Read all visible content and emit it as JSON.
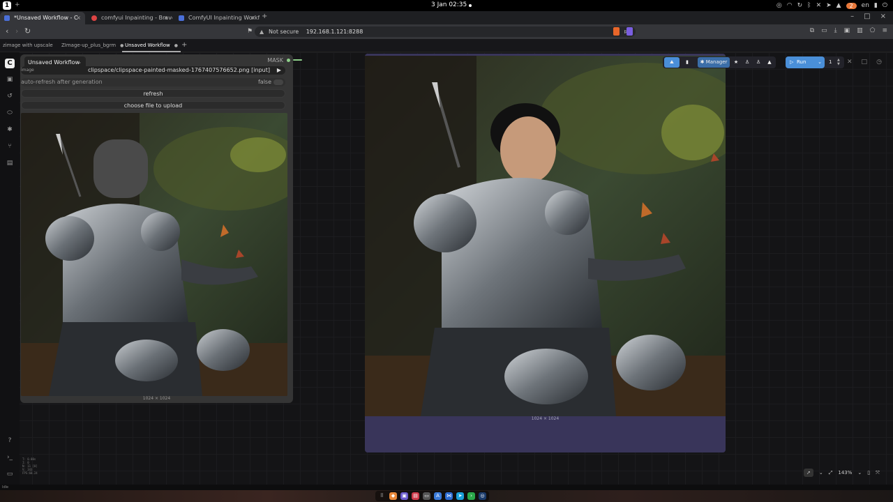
{
  "os": {
    "workspace": "1",
    "clock": "3 Jan 02:35",
    "lang": "en",
    "notification_badge": "2"
  },
  "browser": {
    "tabs": [
      {
        "label": "*Unsaved Workflow - C",
        "active": true
      },
      {
        "label": "comfyui Inpainting - Brave"
      },
      {
        "label": "ComfyUI Inpainting Workflo"
      }
    ],
    "new_tab": "+",
    "security": "Not secure",
    "url": "192.168.1.121:8288"
  },
  "comfy": {
    "workflow_tabs": [
      {
        "label": "zimage with upscale"
      },
      {
        "label": "ZImage-up_plus_bgrm"
      },
      {
        "label": "Unsaved Workflow",
        "active": true
      }
    ],
    "workflow_dropdown": "Unsaved Workflow",
    "load_node": {
      "output_label": "MASK",
      "image_label": "image",
      "image_value": "clipspace/clipspace-painted-masked-1767407576652.png [input]",
      "auto_refresh_label": "auto-refresh after generation",
      "auto_refresh_value": "false",
      "refresh_button": "refresh",
      "upload_button": "choose file to upload",
      "dims": "1024 × 1024"
    },
    "preview_node": {
      "dims": "1024 × 1024"
    },
    "toolbar": {
      "manager_label": "Manager",
      "run_label": "Run",
      "queue_count": "1"
    },
    "zoom": "143%",
    "status": "Idle",
    "stats": [
      "T: 0.00s",
      "I: 0",
      "N: 11 [0]",
      "V: 343",
      "FPS:60.24"
    ]
  }
}
